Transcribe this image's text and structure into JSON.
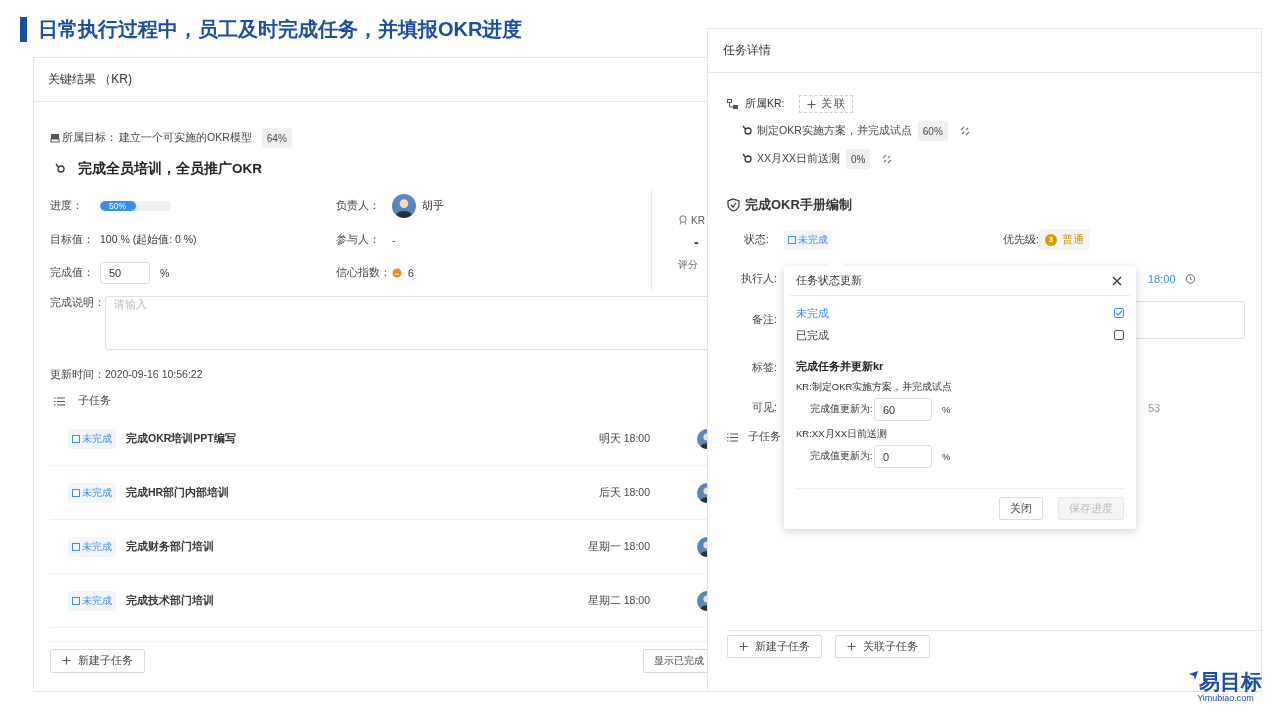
{
  "slide_title": "日常执行过程中，员工及时完成任务，并填报OKR进度",
  "kr_panel": {
    "title": "关键结果 （KR)",
    "objective_label": "所属目标：",
    "objective": "建立一个可实施的OKR模型",
    "objective_progress": "64%",
    "kr_title": "完成全员培训，全员推广OKR",
    "progress_label": "进度：",
    "progress": {
      "level": 0.5,
      "reading": "50%"
    },
    "owner_label": "负责人：",
    "owner": "胡乎",
    "target_label": "目标值：",
    "target": "100 % (起始值: 0 %)",
    "participants_label": "参与人：",
    "participants": "-",
    "done_label": "完成值：",
    "done_value": "50",
    "done_unit": "%",
    "confidence_label": "信心指数：",
    "confidence": "6",
    "score_label": "KR",
    "score": "-",
    "score_rule": "评分",
    "note_label": "完成说明：",
    "note_placeholder": "请输入",
    "updated_label": "更新时间：",
    "updated": "2020-09-16 10:56:22",
    "subtasks_label": "子任务",
    "subtasks": [
      {
        "status": "未完成",
        "name": "完成OKR培训PPT编写",
        "due": "明天 18:00"
      },
      {
        "status": "未完成",
        "name": "完成HR部门内部培训",
        "due": "后天 18:00"
      },
      {
        "status": "未完成",
        "name": "完成财务部门培训",
        "due": "星期一 18:00"
      },
      {
        "status": "未完成",
        "name": "完成技术部门培训",
        "due": "星期二 18:00"
      }
    ],
    "new_subtask": "新建子任务",
    "show_done": "显示已完成"
  },
  "task_panel": {
    "title": "任务详情",
    "kr_label": "所属KR:",
    "link_button": "关 联",
    "krs": [
      {
        "name": "制定OKR实施方案，并完成试点",
        "progress": "60%"
      },
      {
        "name": "XX月XX日前送测",
        "progress": "0%"
      }
    ],
    "task_title": "完成OKR手册编制",
    "status_label": "状态:",
    "status": "未完成",
    "priority_label": "优先级:",
    "priority_number": "3",
    "priority": "普通",
    "assignee_label": "执行人:",
    "due": "18:00",
    "note_label": "备注:",
    "tags_label": "标签:",
    "visible_label": "可见:",
    "visible_tail": "53",
    "subtasks_label": "子任务",
    "buttons": [
      "新建子任务",
      "关联子任务"
    ]
  },
  "task_popup": {
    "title": "任务状态更新",
    "options": [
      {
        "label": "未完成",
        "selected": true
      },
      {
        "label": "已完成",
        "selected": false
      }
    ],
    "section_title": "完成任务并更新kr",
    "krs": [
      {
        "label": "KR:制定OKR实施方案，并完成试点",
        "field_label": "完成值更新为:",
        "value": "60",
        "unit": "%"
      },
      {
        "label": "KR:XX月XX日前送测",
        "field_label": "完成值更新为:",
        "value": "0",
        "unit": "%"
      }
    ],
    "close": "关闭",
    "save": {
      "label": "保存进度",
      "disabled": true
    }
  },
  "logo": {
    "brand": "易目标",
    "url": "Yimubiao.com"
  }
}
